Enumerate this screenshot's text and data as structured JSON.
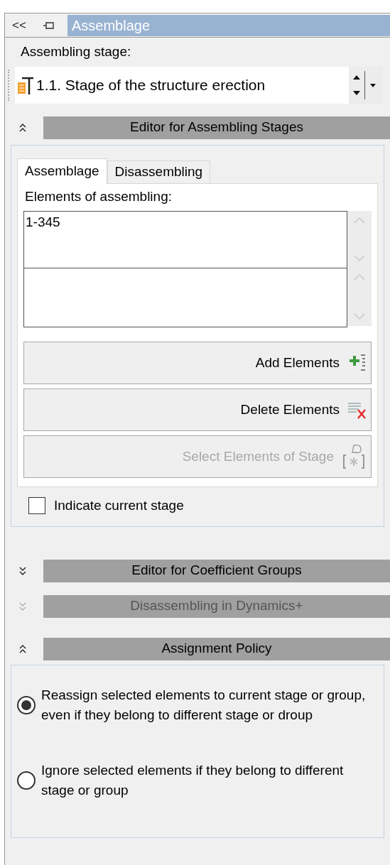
{
  "panel": {
    "collapse_button": "<<",
    "title": "Assemblage"
  },
  "stage": {
    "label": "Assembling stage:",
    "value": "1.1. Stage of the structure erection"
  },
  "sections": [
    {
      "kind": "editor",
      "title": "Editor for Assembling Stages",
      "expanded": true,
      "disabled": false,
      "tabs": [
        {
          "label": "Assemblage",
          "selected": true
        },
        {
          "label": "Disassembling",
          "selected": false
        }
      ],
      "elements_label": "Elements of assembling:",
      "elements_value": "1-345",
      "buttons": [
        {
          "kind": "add",
          "label": "Add Elements",
          "disabled": false
        },
        {
          "kind": "delete",
          "label": "Delete Elements",
          "disabled": false
        },
        {
          "kind": "select",
          "label": "Select Elements of Stage",
          "disabled": true
        }
      ],
      "checkbox": {
        "label": "Indicate current stage",
        "checked": false
      }
    },
    {
      "kind": "header",
      "title": "Editor for Coefficient Groups",
      "expanded": false,
      "disabled": false
    },
    {
      "kind": "header",
      "title": "Disassembling in Dynamics+",
      "expanded": false,
      "disabled": true
    },
    {
      "kind": "policy",
      "title": "Assignment Policy",
      "expanded": true,
      "disabled": false,
      "options": [
        {
          "label": "Reassign selected elements to current stage or group, even if they belong to different stage or droup",
          "selected": true
        },
        {
          "label": "Ignore selected elements if they belong to different stage or group",
          "selected": false
        }
      ]
    }
  ]
}
